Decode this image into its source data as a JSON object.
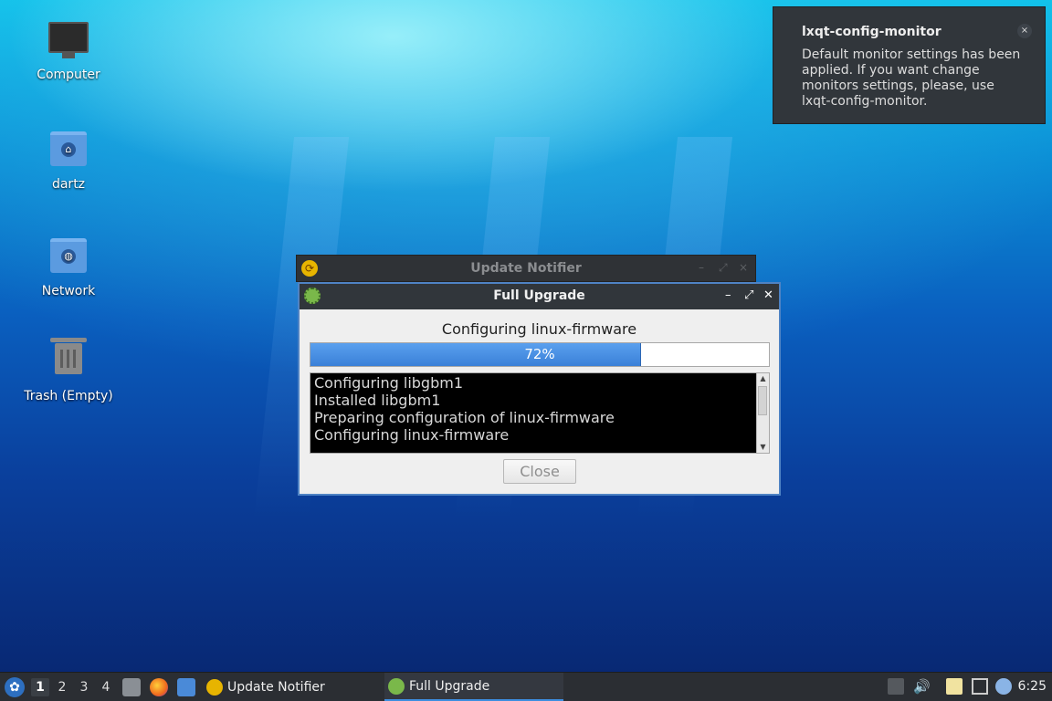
{
  "desktop": {
    "icons": [
      {
        "label": "Computer",
        "icon": "computer-icon"
      },
      {
        "label": "dartz",
        "icon": "home-folder-icon"
      },
      {
        "label": "Network",
        "icon": "network-folder-icon"
      },
      {
        "label": "Trash (Empty)",
        "icon": "trash-icon"
      }
    ]
  },
  "notification": {
    "title": "lxqt-config-monitor",
    "body": "Default monitor settings has been applied. If you want change monitors settings, please, use lxqt-config-monitor.",
    "close": "×"
  },
  "background_window": {
    "title": "Update Notifier",
    "controls": {
      "minimize": "–",
      "maximize": "⤢",
      "close": "×"
    }
  },
  "dialog": {
    "title": "Full Upgrade",
    "controls": {
      "minimize": "–",
      "maximize": "⤢",
      "close": "✕"
    },
    "status": "Configuring linux-firmware",
    "progress_label": "72%",
    "progress_value": 0.72,
    "log_lines": [
      "Configuring libgbm1",
      "Installed libgbm1",
      "Preparing configuration of linux-firmware",
      "Configuring linux-firmware"
    ],
    "close_button": "Close"
  },
  "taskbar": {
    "workspaces": [
      "1",
      "2",
      "3",
      "4"
    ],
    "active_workspace": "1",
    "tasks": [
      {
        "label": "Update Notifier",
        "icon": "update-notifier-icon"
      },
      {
        "label": "Full Upgrade",
        "icon": "gear-icon"
      }
    ],
    "clock": "6:25"
  },
  "colors": {
    "accent": "#3d8ee0",
    "panel": "#2b2e33",
    "titlebar": "#31363b",
    "progress": "#4a90e2"
  }
}
